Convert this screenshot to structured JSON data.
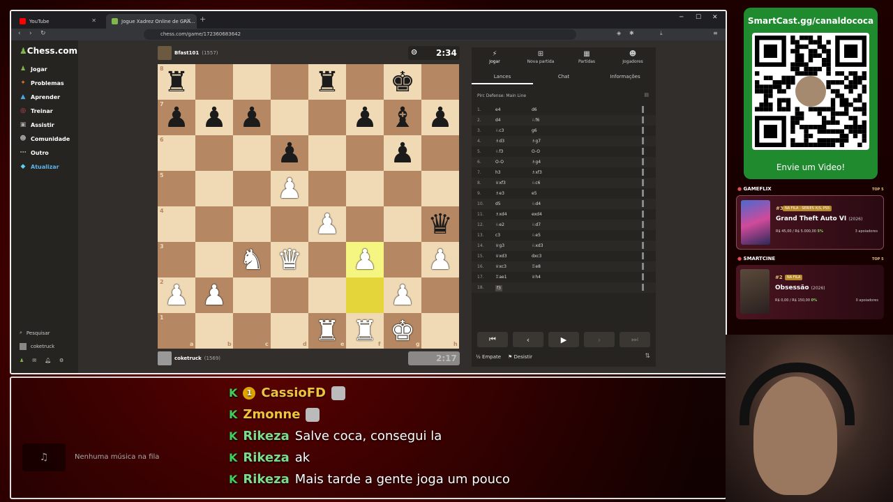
{
  "browser": {
    "tabs": [
      {
        "label": "YouTube"
      },
      {
        "label": "Jogue Xadrez Online de GRA..."
      }
    ],
    "url": "chess.com/game/172360683642"
  },
  "sidebar": {
    "logo": "Chess.com",
    "items": [
      {
        "label": "Jogar",
        "icon": "pawn-icon"
      },
      {
        "label": "Problemas",
        "icon": "puzzle-icon"
      },
      {
        "label": "Aprender",
        "icon": "cap-icon"
      },
      {
        "label": "Treinar",
        "icon": "target-icon"
      },
      {
        "label": "Assistir",
        "icon": "tv-icon"
      },
      {
        "label": "Comunidade",
        "icon": "people-icon"
      },
      {
        "label": "Outro",
        "icon": "dots-icon"
      },
      {
        "label": "Atualizar",
        "icon": "diamond-icon"
      }
    ],
    "search": "Pesquisar",
    "user": "coketruck"
  },
  "top_player": {
    "name": "Bfast101",
    "rating": "(1557)",
    "clock": "2:34"
  },
  "bottom_player": {
    "name": "coketruck",
    "rating": "(1569)",
    "clock": "2:17"
  },
  "board": {
    "files": [
      "a",
      "b",
      "c",
      "d",
      "e",
      "f",
      "g",
      "h"
    ],
    "ranks": [
      "8",
      "7",
      "6",
      "5",
      "4",
      "3",
      "2",
      "1"
    ]
  },
  "panel": {
    "tabs": [
      "Jogar",
      "Nova partida",
      "Partidas",
      "Jogadores"
    ],
    "subtabs": [
      "Lances",
      "Chat",
      "Informações"
    ],
    "opening": "Pirc Defense: Main Line",
    "moves": [
      [
        "1.",
        "e4",
        "d6"
      ],
      [
        "2.",
        "d4",
        "♘f6"
      ],
      [
        "3.",
        "♘c3",
        "g6"
      ],
      [
        "4.",
        "♗d3",
        "♗g7"
      ],
      [
        "5.",
        "♘f3",
        "O-O"
      ],
      [
        "6.",
        "O-O",
        "♗g4"
      ],
      [
        "7.",
        "h3",
        "♗xf3"
      ],
      [
        "8.",
        "♕xf3",
        "♘c6"
      ],
      [
        "9.",
        "♗e3",
        "e5"
      ],
      [
        "10.",
        "d5",
        "♘d4"
      ],
      [
        "11.",
        "♗xd4",
        "exd4"
      ],
      [
        "12.",
        "♘e2",
        "♘d7"
      ],
      [
        "13.",
        "c3",
        "♘e5"
      ],
      [
        "14.",
        "♕g3",
        "♘xd3"
      ],
      [
        "15.",
        "♕xd3",
        "dxc3"
      ],
      [
        "16.",
        "♕xc3",
        "♖e8"
      ],
      [
        "17.",
        "♖ae1",
        "♕h4"
      ],
      [
        "18.",
        "f3",
        ""
      ]
    ],
    "draw": "Empate",
    "resign": "Desistir"
  },
  "qr": {
    "title": "SmartCast.gg/canaldococa",
    "cta": "Envie um Video!"
  },
  "gameflix": {
    "section": "GAMEFLIX",
    "top": "TOP 5",
    "rank": "#3",
    "badge": "NA FILA · SERIES X|S, PS5",
    "title": "Grand Theft Auto VI",
    "year": "(2026)",
    "raised": "R$ 45,00",
    "goal": "/ R$ 5.000,00",
    "pct": "5%",
    "supporters": "3 apoiadores"
  },
  "smartcine": {
    "section": "SMARTCINE",
    "top": "TOP 5",
    "rank": "#2",
    "badge": "NA FILA",
    "title": "Obsessão",
    "year": "(2026)",
    "raised": "R$ 0,00",
    "goal": "/ R$ 150,00",
    "pct": "0%",
    "supporters": "0 apoiadores"
  },
  "music": {
    "text": "Nenhuma música na fila"
  },
  "chat": [
    {
      "user": "CassioFD",
      "msg": "",
      "gold": true
    },
    {
      "user": "Zmonne",
      "msg": "",
      "gold": true
    },
    {
      "user": "Rikeza",
      "msg": "Salve coca, consegui la",
      "gold": false
    },
    {
      "user": "Rikeza",
      "msg": "ak",
      "gold": false
    },
    {
      "user": "Rikeza",
      "msg": "Mais tarde a gente joga um pouco",
      "gold": false
    }
  ]
}
